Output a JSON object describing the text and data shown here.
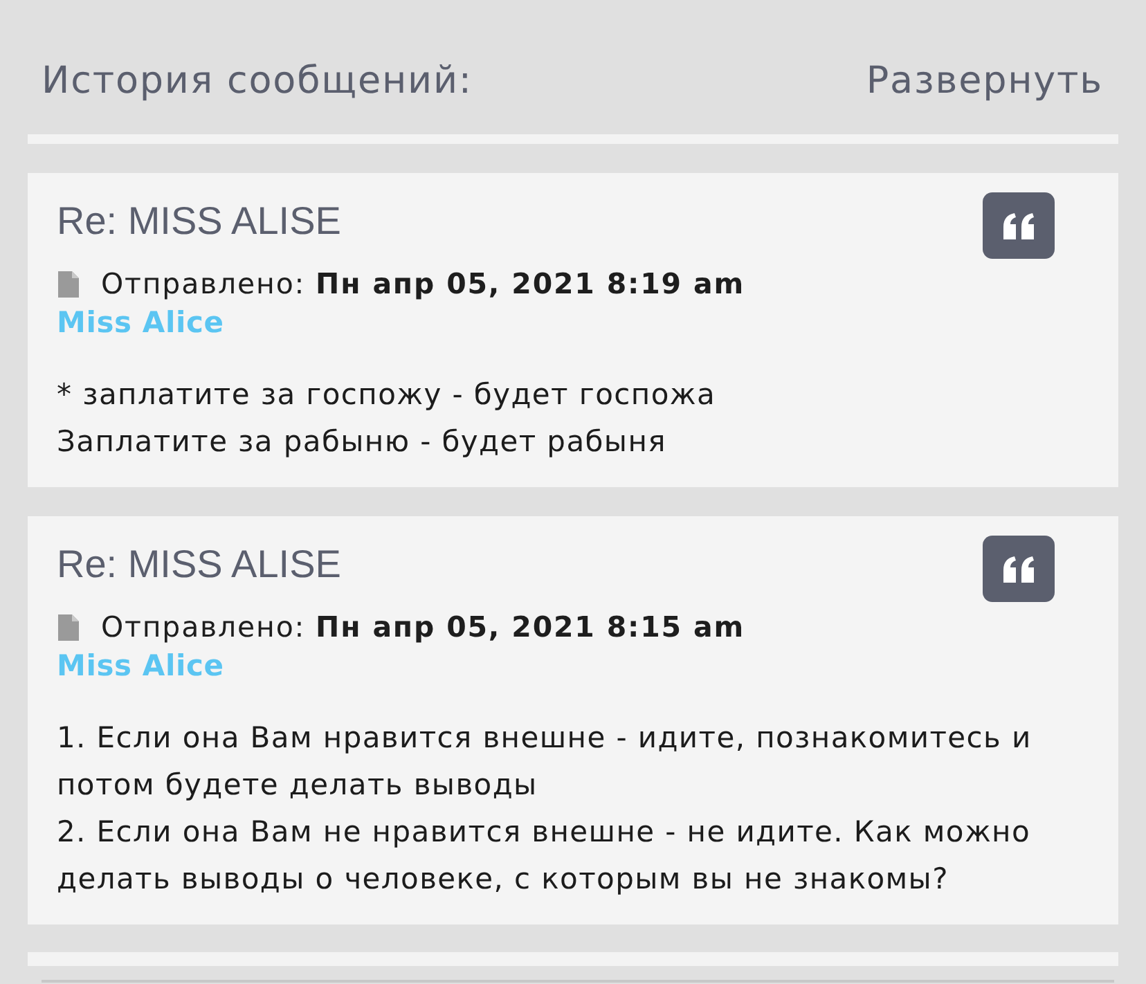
{
  "header": {
    "title": "История сообщений:",
    "expand_link": "Развернуть"
  },
  "posts": [
    {
      "title": "Re: MISS ALISE",
      "meta": "Отправлено: **Пн апр 05, 2021 8:19 am**",
      "author": "Miss Alice",
      "body": [
        "* заплатите за госпожу - будет госпожа",
        "Заплатите за рабыню - будет рабыня"
      ]
    },
    {
      "title": "Re: MISS ALISE",
      "meta": "Отправлено: **Пн апр 05, 2021 8:15 am**",
      "author": "Miss Alice",
      "body": [
        "1. Если она Вам нравится внешне - идите, познакомитесь и потом будете делать выводы",
        "2. Если она Вам не нравится внешне - не идите. Как можно делать выводы о человеке, с которым вы не знакомы?"
      ]
    }
  ]
}
